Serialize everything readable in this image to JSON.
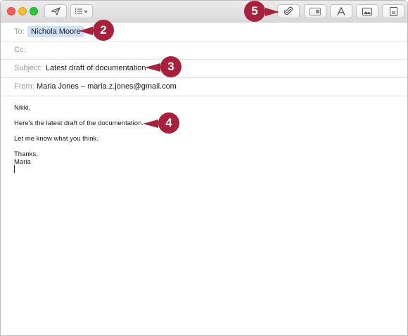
{
  "fields": {
    "to_label": "To:",
    "to_recipient": "Nichola Moore",
    "cc_label": "Cc:",
    "subject_label": "Subject:",
    "subject_value": "Latest draft of documentation",
    "from_label": "From:",
    "from_value": "Maria Jones – maria.z.jones@gmail.com"
  },
  "message": {
    "greeting": "Nikki,",
    "line1": "Here's the latest draft of the documentation.",
    "line2": "Let me know what you think.",
    "closing": "Thanks,",
    "signature": "Maria"
  },
  "callouts": {
    "c2": "2",
    "c3": "3",
    "c4": "4",
    "c5": "5"
  },
  "toolbar": {
    "icons": [
      "send-icon",
      "header-fields-icon",
      "attach-icon",
      "photo-browser-icon",
      "format-icon",
      "image-icon",
      "stationery-icon"
    ]
  },
  "colors": {
    "callout": "#a8203b",
    "recipient_chip": "#cfe1fb"
  }
}
